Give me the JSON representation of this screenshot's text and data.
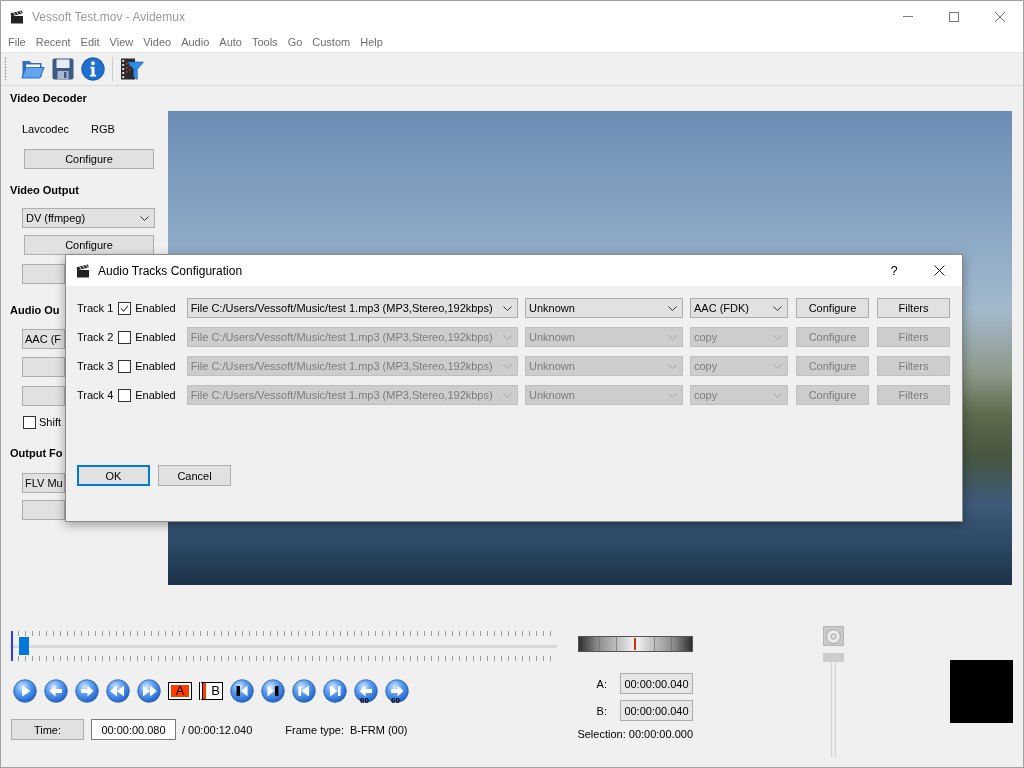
{
  "window": {
    "title": "Vessoft Test.mov - Avidemux"
  },
  "menu": [
    "File",
    "Recent",
    "Edit",
    "View",
    "Video",
    "Audio",
    "Auto",
    "Tools",
    "Go",
    "Custom",
    "Help"
  ],
  "toolbar": [
    {
      "kind": "open"
    },
    {
      "kind": "save"
    },
    {
      "kind": "info"
    },
    {
      "kind": "separator"
    },
    {
      "kind": "filters"
    }
  ],
  "left_panel": {
    "video_decoder": {
      "heading": "Video Decoder",
      "decoder": "Lavcodec",
      "format": "RGB",
      "button": "Configure"
    },
    "video_output": {
      "heading": "Video Output",
      "codec": "DV (ffmpeg)",
      "button": "Configure"
    },
    "audio_output": {
      "heading": "Audio Ou",
      "codec": "AAC (F",
      "shift": {
        "label": "Shift",
        "checked": false
      }
    },
    "output_format": {
      "heading": "Output Fo",
      "format": "FLV Mu"
    }
  },
  "dialog": {
    "title": "Audio Tracks Configuration",
    "help": "?",
    "tracks": [
      {
        "label": "Track 1",
        "enabled": true,
        "enabled_label": "Enabled",
        "source": "File C:/Users/Vessoft/Music/test 1.mp3 (MP3,Stereo,192kbps)",
        "language": "Unknown",
        "codec": "AAC (FDK)",
        "configure": "Configure",
        "filters": "Filters"
      },
      {
        "label": "Track 2",
        "enabled": false,
        "enabled_label": "Enabled",
        "source": "File C:/Users/Vessoft/Music/test 1.mp3 (MP3,Stereo,192kbps)",
        "language": "Unknown",
        "codec": "copy",
        "configure": "Configure",
        "filters": "Filters"
      },
      {
        "label": "Track 3",
        "enabled": false,
        "enabled_label": "Enabled",
        "source": "File C:/Users/Vessoft/Music/test 1.mp3 (MP3,Stereo,192kbps)",
        "language": "Unknown",
        "codec": "copy",
        "configure": "Configure",
        "filters": "Filters"
      },
      {
        "label": "Track 4",
        "enabled": false,
        "enabled_label": "Enabled",
        "source": "File C:/Users/Vessoft/Music/test 1.mp3 (MP3,Stereo,192kbps)",
        "language": "Unknown",
        "codec": "copy",
        "configure": "Configure",
        "filters": "Filters"
      }
    ],
    "ok": "OK",
    "cancel": "Cancel"
  },
  "timeline": {
    "level": 0.01
  },
  "nav_buttons": [
    {
      "kind": "play"
    },
    {
      "kind": "previous-frame"
    },
    {
      "kind": "next-frame"
    },
    {
      "kind": "previous-keyframe"
    },
    {
      "kind": "next-keyframe"
    },
    {
      "kind": "marker-a",
      "label": "A"
    },
    {
      "kind": "marker-b",
      "label": "B"
    },
    {
      "kind": "previous-black"
    },
    {
      "kind": "next-black"
    },
    {
      "kind": "first-frame"
    },
    {
      "kind": "last-frame"
    },
    {
      "kind": "back-60",
      "label": "60"
    },
    {
      "kind": "forward-60",
      "label": "60"
    }
  ],
  "time": {
    "button": "Time:",
    "value": "00:00:00.080",
    "total": "/ 00:00:12.040",
    "frame_type_label": "Frame type:",
    "frame_type": "B-FRM (00)"
  },
  "selection": {
    "a_label": "A:",
    "a_value": "00:00:00.040",
    "b_label": "B:",
    "b_value": "00:00:00.040",
    "summary": "Selection: 00:00:00.000"
  },
  "volume": {
    "level": 1
  }
}
